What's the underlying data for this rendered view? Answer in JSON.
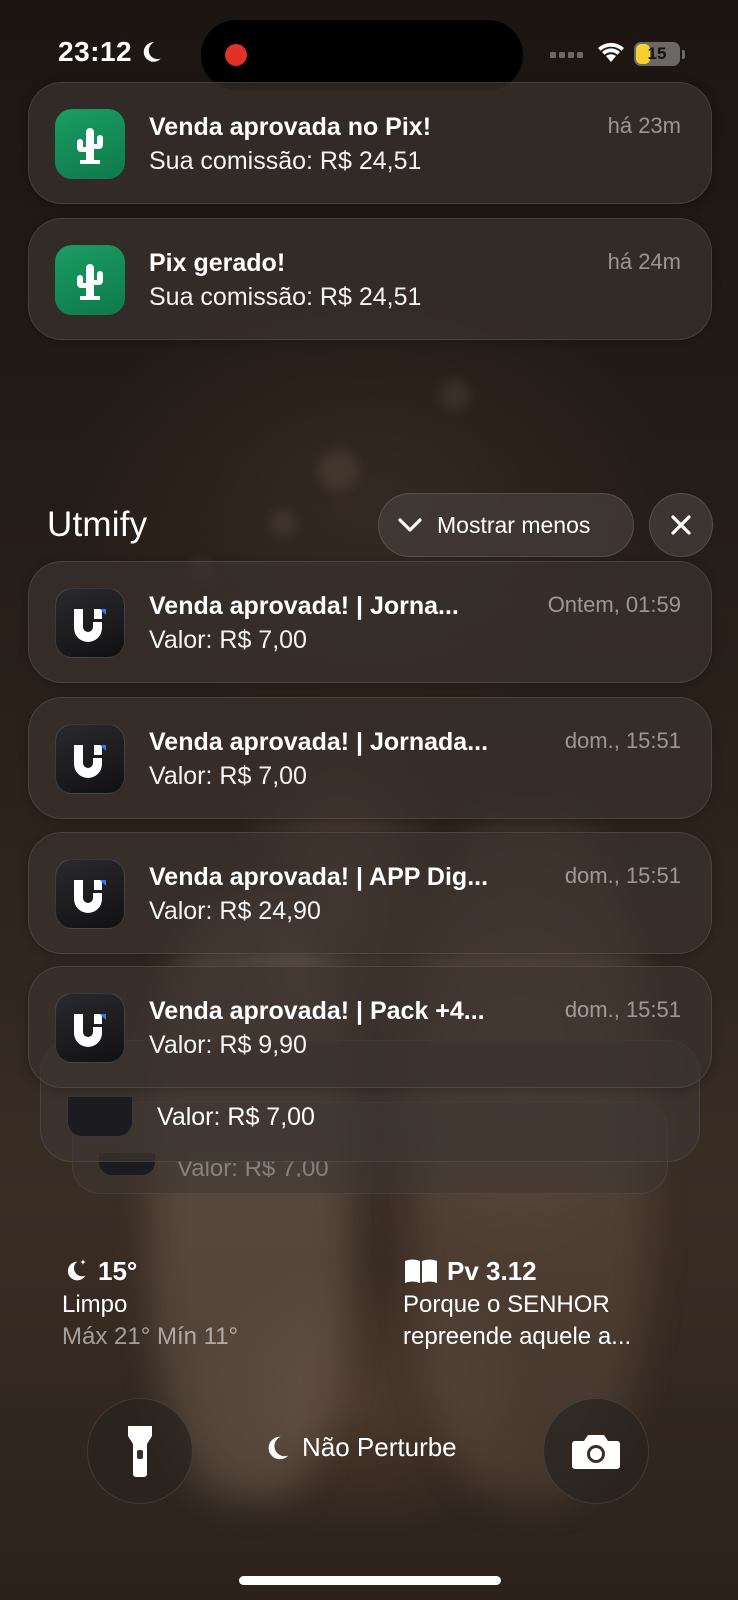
{
  "status_bar": {
    "time": "23:12",
    "focus_icon": "moon-icon",
    "recording_color": "#e0322b",
    "battery_level": "15",
    "battery_fraction": 0.15,
    "battery_color": "#f5d031"
  },
  "notifications_top": [
    {
      "app_icon": "cactus-icon",
      "title": "Venda aprovada no Pix!",
      "body": "Sua comissão: R$ 24,51",
      "time": "há 23m"
    },
    {
      "app_icon": "cactus-icon",
      "title": "Pix gerado!",
      "body": "Sua comissão: R$ 24,51",
      "time": "há 24m"
    }
  ],
  "group": {
    "name": "Utmify",
    "show_less_label": "Mostrar menos",
    "items": [
      {
        "app_icon": "utmify-icon",
        "title": "Venda aprovada! | Jorna...",
        "body": "Valor: R$ 7,00",
        "time": "Ontem, 01:59"
      },
      {
        "app_icon": "utmify-icon",
        "title": "Venda aprovada! | Jornada...",
        "body": "Valor: R$ 7,00",
        "time": "dom., 15:51"
      },
      {
        "app_icon": "utmify-icon",
        "title": "Venda aprovada! | APP Dig...",
        "body": "Valor: R$ 24,90",
        "time": "dom., 15:51"
      },
      {
        "app_icon": "utmify-icon",
        "title": "Venda aprovada! | Pack +4...",
        "body": "Valor: R$ 9,90",
        "time": "dom., 15:51"
      }
    ],
    "stacked": [
      {
        "body": "Valor: R$ 7,00"
      },
      {
        "body": "Valor: R$ 7,00"
      }
    ]
  },
  "widgets": {
    "weather": {
      "temp": "15°",
      "condition": "Limpo",
      "range": "Máx 21° Mín 11°"
    },
    "verse": {
      "reference": "Pv 3.12",
      "line1": "Porque o SENHOR",
      "line2": "repreende aquele a..."
    }
  },
  "bottom": {
    "focus_label": "Não Perturbe"
  }
}
